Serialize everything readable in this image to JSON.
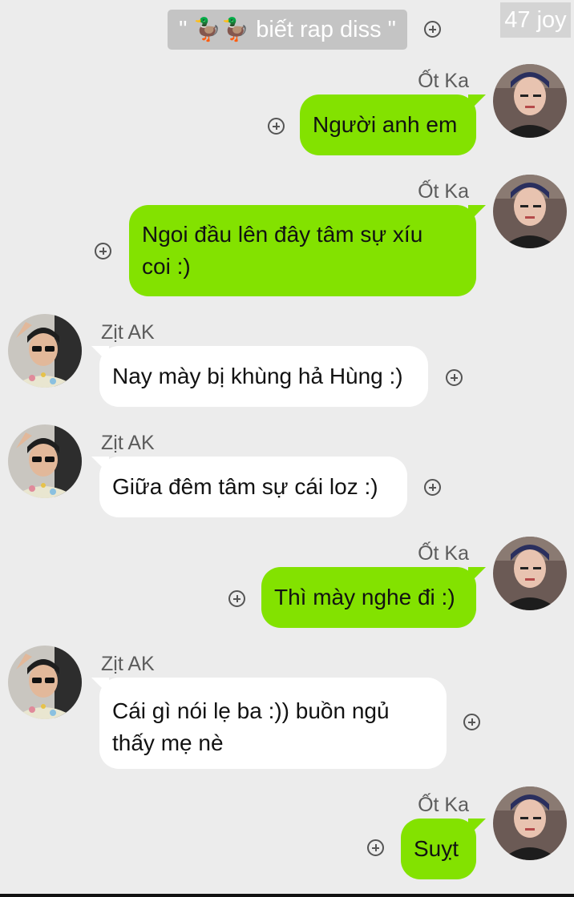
{
  "header": {
    "quote_open": "\" ",
    "duck_emoji": "🦆🦆",
    "text": " biết rap diss \"",
    "watermark": "47 joy"
  },
  "senders": {
    "me": "Ốt Ka",
    "other": "Zịt AK"
  },
  "messages": [
    {
      "sender": "Ốt Ka",
      "text": "Người anh em"
    },
    {
      "sender": "Ốt Ka",
      "text": "Ngoi đầu lên đây tâm sự xíu\ncoi :)"
    },
    {
      "sender": "Zịt AK",
      "text": "Nay mày bị khùng hả Hùng :)"
    },
    {
      "sender": "Zịt AK",
      "text": "Giữa đêm tâm sự cái loz :)"
    },
    {
      "sender": "Ốt Ka",
      "text": "Thì mày nghe đi :)"
    },
    {
      "sender": "Zịt AK",
      "text": "Cái gì nói lẹ ba :)) buồn ngủ\nthấy mẹ nè"
    },
    {
      "sender": "Ốt Ka",
      "text": "Suỵt"
    }
  ],
  "colors": {
    "outgoing_bubble": "#83e200",
    "incoming_bubble": "#ffffff",
    "background": "#ececec"
  },
  "icons": {
    "reaction": "add-reaction-icon"
  }
}
